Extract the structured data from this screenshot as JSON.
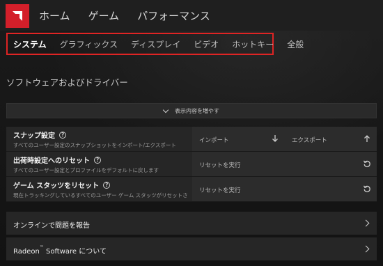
{
  "main_nav": [
    "ホーム",
    "ゲーム",
    "パフォーマンス"
  ],
  "sub_nav": {
    "tabs": [
      "システム",
      "グラフィックス",
      "ディスプレイ",
      "ビデオ",
      "ホットキー",
      "全般"
    ],
    "active": "システム"
  },
  "section_title": "ソフトウェアおよびドライバー",
  "expand_label": "表示内容を増やす",
  "settings": [
    {
      "title": "スナップ設定",
      "desc": "すべてのユーザー設定のスナップショットをインポート/エクスポート",
      "actions": [
        {
          "label": "インポート",
          "icon": "download-arrow-icon"
        },
        {
          "label": "エクスポート",
          "icon": "upload-arrow-icon"
        }
      ]
    },
    {
      "title": "出荷時設定へのリセット",
      "desc": "すべてのユーザー設定とプロファイルをデフォルトに戻します",
      "actions": [
        {
          "label": "リセットを実行",
          "icon": "reset-icon"
        }
      ]
    },
    {
      "title": "ゲーム スタッツをリセット",
      "desc": "現在トラッキングしているすべてのユーザー ゲーム スタッツがリセットされ...",
      "actions": [
        {
          "label": "リセットを実行",
          "icon": "reset-icon"
        }
      ]
    }
  ],
  "cards": [
    {
      "label": "オンラインで問題を報告"
    },
    {
      "label_prefix": "Radeon",
      "label_tm": "™",
      "label_suffix": " Software について"
    }
  ],
  "colors": {
    "accent": "#e02424",
    "logo": "#d31f2a"
  }
}
